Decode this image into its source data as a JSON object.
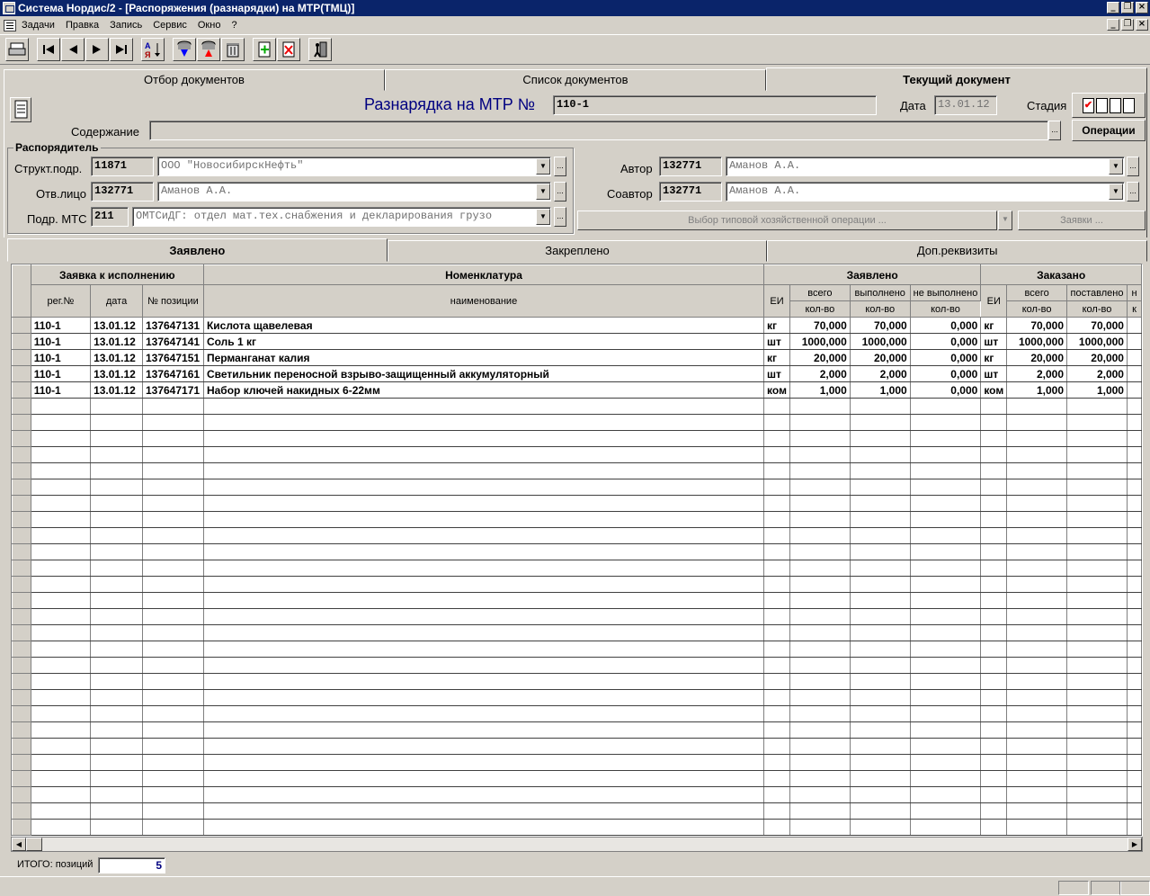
{
  "window": {
    "title": "Система Нордис/2 - [Распоряжения (разнарядки) на МТР(ТМЦ)]"
  },
  "menu": [
    "Задачи",
    "Правка",
    "Запись",
    "Сервис",
    "Окно",
    "?"
  ],
  "toolbar_icons": [
    "print-icon",
    "first-record-icon",
    "prev-record-icon",
    "next-record-icon",
    "last-record-icon",
    "sort-icon",
    "save-down-icon",
    "load-up-icon",
    "trash-icon",
    "add-record-icon",
    "delete-record-icon",
    "exit-icon"
  ],
  "top_tabs": [
    "Отбор документов",
    "Список документов",
    "Текущий документ"
  ],
  "doc": {
    "heading": "Разнарядка на МТР №",
    "number": "110-1",
    "date_label": "Дата",
    "date": "13.01.12",
    "stage_label": "Стадия",
    "content_label": "Содержание",
    "content": "",
    "operations_btn": "Операции"
  },
  "dispatcher": {
    "group_label": "Распорядитель",
    "struct_label": "Структ.подр.",
    "struct_code": "11871",
    "struct_name": "ООО \"НовосибирскНефть\"",
    "resp_label": "Отв.лицо",
    "resp_code": "132771",
    "resp_name": "Аманов А.А.",
    "mts_label": "Подр. МТС",
    "mts_code": "211",
    "mts_name": "ОМТСиДГ: отдел мат.тех.снабжения и декларирования грузо"
  },
  "author": {
    "author_label": "Автор",
    "author_code": "132771",
    "author_name": "Аманов А.А.",
    "coauthor_label": "Соавтор",
    "coauthor_code": "132771",
    "coauthor_name": "Аманов А.А.",
    "operation_btn": "Выбор типовой хозяйственной операции ...",
    "requests_btn": "Заявки ..."
  },
  "sub_tabs": [
    "Заявлено",
    "Закреплено",
    "Доп.реквизиты"
  ],
  "grid": {
    "group_headers": [
      "Заявка к исполнению",
      "Номенклатура",
      "Заявлено",
      "Заказано"
    ],
    "headers": [
      "рег.№",
      "дата",
      "№ позиции",
      "наименование",
      "ЕИ",
      "всего",
      "выполнено",
      "не выполнено",
      "ЕИ",
      "всего",
      "поставлено",
      "н"
    ],
    "subheaders": [
      "кол-во",
      "кол-во",
      "кол-во",
      "кол-во",
      "кол-во",
      "к"
    ],
    "rows": [
      [
        "110-1",
        "13.01.12",
        "137647131",
        "Кислота щавелевая",
        "кг",
        "70,000",
        "70,000",
        "0,000",
        "кг",
        "70,000",
        "70,000"
      ],
      [
        "110-1",
        "13.01.12",
        "137647141",
        "Соль 1 кг",
        "шт",
        "1000,000",
        "1000,000",
        "0,000",
        "шт",
        "1000,000",
        "1000,000"
      ],
      [
        "110-1",
        "13.01.12",
        "137647151",
        "Перманганат калия",
        "кг",
        "20,000",
        "20,000",
        "0,000",
        "кг",
        "20,000",
        "20,000"
      ],
      [
        "110-1",
        "13.01.12",
        "137647161",
        "Светильник переносной взрыво-защищенный аккумуляторный",
        "шт",
        "2,000",
        "2,000",
        "0,000",
        "шт",
        "2,000",
        "2,000"
      ],
      [
        "110-1",
        "13.01.12",
        "137647171",
        "Набор ключей накидных 6-22мм",
        "ком",
        "1,000",
        "1,000",
        "0,000",
        "ком",
        "1,000",
        "1,000"
      ]
    ]
  },
  "footer": {
    "total_label": "ИТОГО: позиций",
    "total_value": "5"
  }
}
